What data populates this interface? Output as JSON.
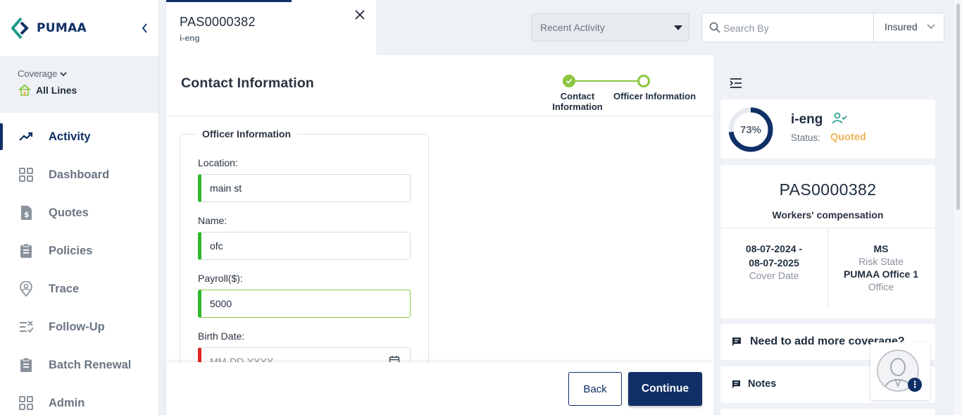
{
  "brand": {
    "name": "PUMAA"
  },
  "coverage": {
    "label": "Coverage",
    "value": "All Lines"
  },
  "nav": {
    "items": [
      {
        "label": "Activity",
        "icon": "trending-up-icon",
        "active": true
      },
      {
        "label": "Dashboard",
        "icon": "grid-icon"
      },
      {
        "label": "Quotes",
        "icon": "dollar-document-icon"
      },
      {
        "label": "Policies",
        "icon": "clipboard-icon"
      },
      {
        "label": "Trace",
        "icon": "location-person-icon"
      },
      {
        "label": "Follow-Up",
        "icon": "checklist-icon"
      },
      {
        "label": "Batch Renewal",
        "icon": "clipboard-icon"
      },
      {
        "label": "Admin",
        "icon": "grid-icon"
      }
    ]
  },
  "tab": {
    "title": "PAS0000382",
    "subtitle": "i-eng"
  },
  "recent": {
    "label": "Recent Activity"
  },
  "search": {
    "placeholder": "Search By",
    "filter": "Insured"
  },
  "main": {
    "title": "Contact Information",
    "steps": [
      {
        "label": "Contact Information",
        "done": true
      },
      {
        "label": "Officer Information",
        "current": true
      }
    ],
    "section_title": "Officer Information",
    "fields": {
      "location": {
        "label": "Location:",
        "value": "main st"
      },
      "name": {
        "label": "Name:",
        "value": "ofc"
      },
      "payroll": {
        "label": "Payroll($):",
        "value": "5000"
      },
      "birth_date": {
        "label": "Birth Date:",
        "placeholder": "MM-DD-YYYY"
      }
    },
    "back_label": "Back",
    "continue_label": "Continue"
  },
  "summary": {
    "progress_pct": 73,
    "progress_text": "73%",
    "insured": "i-eng",
    "status_label": "Status:",
    "status_value": "Quoted",
    "policy_number": "PAS0000382",
    "line_of_business": "Workers' compensation",
    "date_start": "08-07-2024 -",
    "date_end": "08-07-2025",
    "cover_date_label": "Cover Date",
    "risk_state": "MS",
    "risk_state_label": "Risk State",
    "office": "PUMAA Office 1",
    "office_label": "Office",
    "more_coverage": "Need to add more coverage?",
    "notes": "Notes"
  },
  "colors": {
    "primary": "#0f2f66",
    "accent_green": "#8cc63f",
    "valid_green": "#2db82d",
    "error_red": "#e02424",
    "status_quoted": "#f0b45a"
  }
}
